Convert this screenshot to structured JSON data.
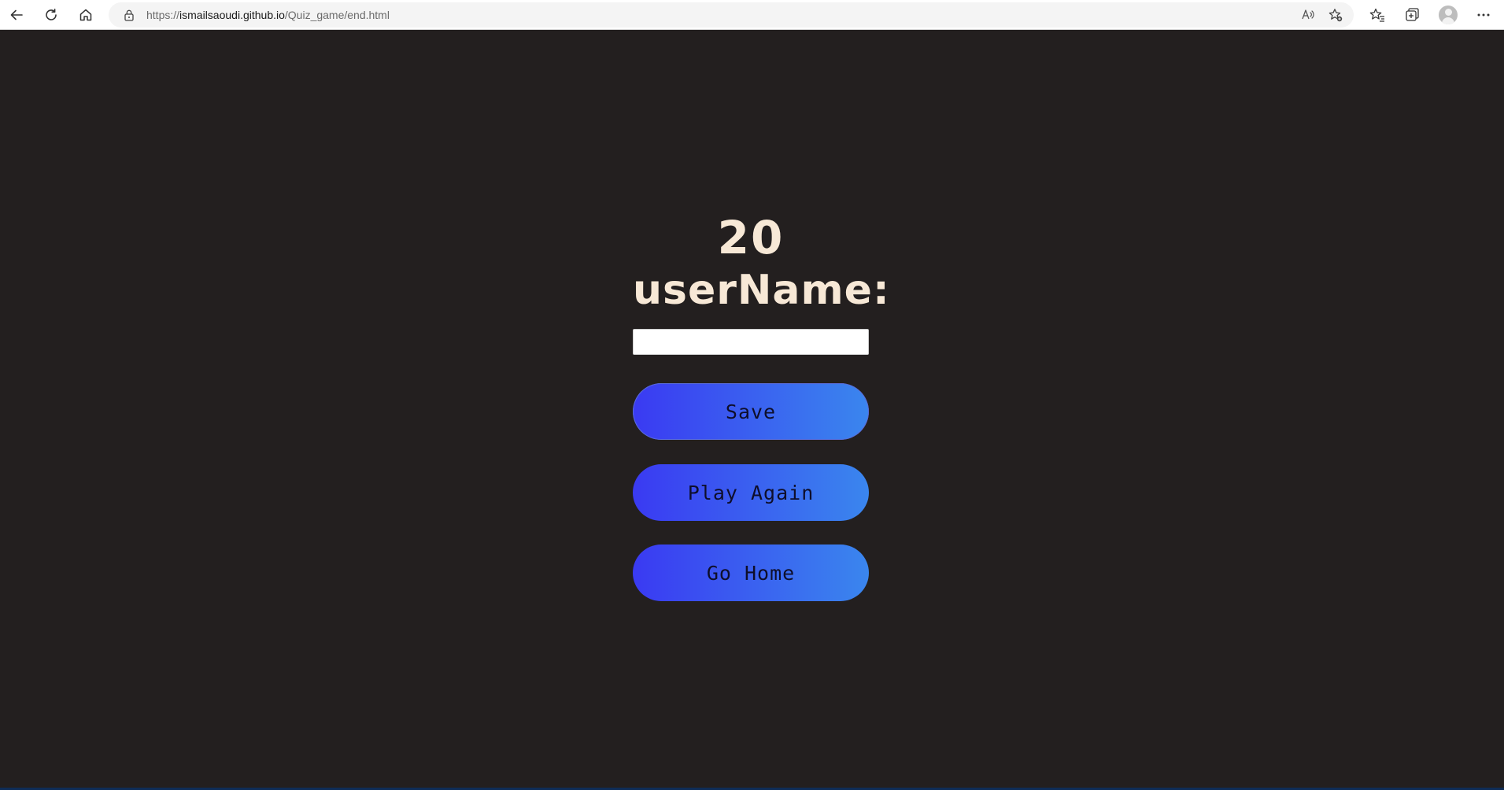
{
  "browser": {
    "url_prefix": "https://",
    "url_host": "ismailsaoudi.github.io",
    "url_path": "/Quiz_game/end.html",
    "icons": {
      "back": "back-arrow-icon",
      "refresh": "refresh-icon",
      "home": "home-icon",
      "lock": "lock-icon",
      "read_aloud": "read-aloud-icon",
      "add_favorite": "add-favorite-icon",
      "favorites": "favorites-icon",
      "collections": "collections-icon",
      "profile": "profile-avatar",
      "menu": "more-menu-icon"
    }
  },
  "end_screen": {
    "score": "20",
    "username_label": "userName:",
    "username_value": "",
    "username_placeholder": "",
    "save_label": "Save",
    "play_again_label": "Play Again",
    "go_home_label": "Go Home"
  },
  "colors": {
    "background": "#231f1f",
    "text": "#f7e8d6",
    "button_gradient_start": "#3a3af2",
    "button_gradient_end": "#3a86ee"
  }
}
